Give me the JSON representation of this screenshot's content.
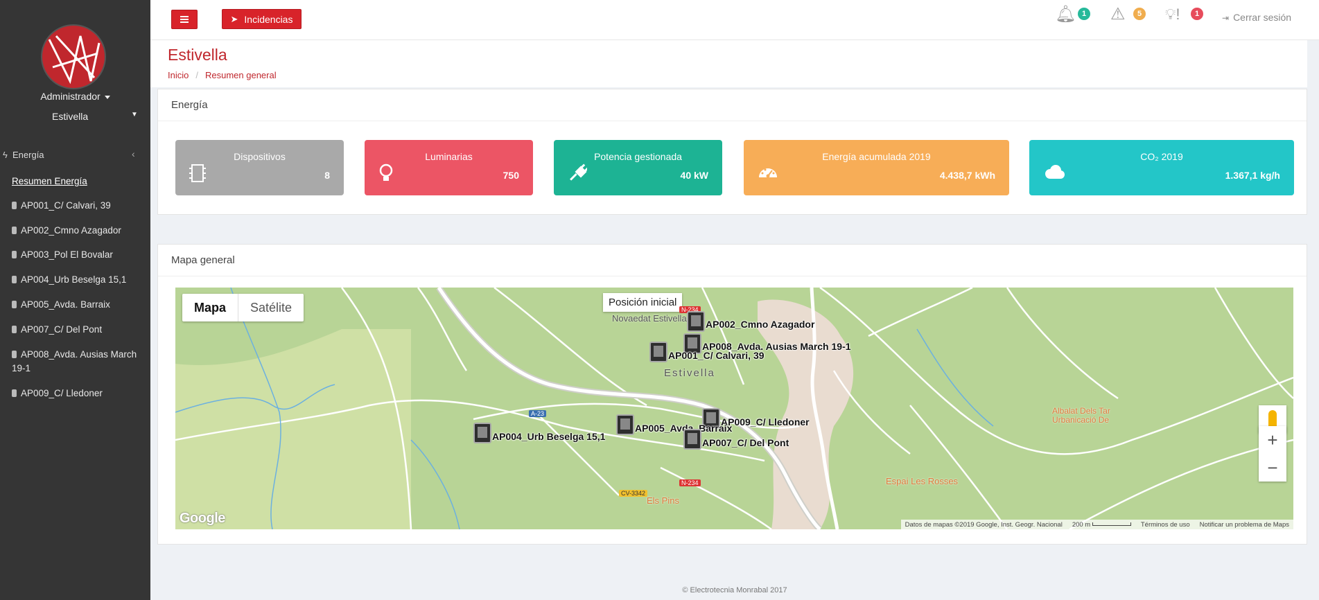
{
  "sidebar": {
    "user_role": "Administrador",
    "site": "Estivella",
    "group": {
      "label": "Energía"
    },
    "items": [
      {
        "label": "Resumen Energía",
        "active": true
      },
      {
        "label": "AP001_C/ Calvari, 39"
      },
      {
        "label": "AP002_Cmno Azagador"
      },
      {
        "label": "AP003_Pol El Bovalar"
      },
      {
        "label": "AP004_Urb Beselga 15,1"
      },
      {
        "label": "AP005_Avda. Barraix"
      },
      {
        "label": "AP007_C/ Del Pont"
      },
      {
        "label": "AP008_Avda. Ausias March 19-1"
      },
      {
        "label": "AP009_C/ Lledoner"
      }
    ]
  },
  "header": {
    "incidencias_label": "Incidencias",
    "notifications_count": "1",
    "warnings_count": "5",
    "lamp_alerts_count": "1",
    "logout_label": "Cerrar sesión",
    "colors": {
      "green": "#26b99a",
      "orange": "#f0ad4e",
      "red": "#e74c5c"
    }
  },
  "page": {
    "title": "Estivella",
    "breadcrumb": [
      "Inicio",
      "Resumen general"
    ]
  },
  "energy_panel": {
    "title": "Energía",
    "stats": [
      {
        "label": "Dispositivos",
        "value": "8",
        "icon": "chip-icon",
        "color": "#a9a9a9"
      },
      {
        "label": "Luminarias",
        "value": "750",
        "icon": "lightbulb-icon",
        "color": "#ec5565"
      },
      {
        "label": "Potencia gestionada",
        "value": "40 kW",
        "icon": "plug-icon",
        "color": "#1db394"
      },
      {
        "label": "Energía acumulada 2019",
        "value": "4.438,7 kWh",
        "icon": "gauge-icon",
        "color": "#f7ad57"
      },
      {
        "label": "CO₂ 2019",
        "value": "1.367,1 kg/h",
        "icon": "cloud-icon",
        "color": "#23c6c8"
      }
    ]
  },
  "map_panel": {
    "title": "Mapa general",
    "map_type": {
      "map": "Mapa",
      "satellite": "Satélite"
    },
    "tooltip": "Posición inicial",
    "markers": [
      "AP002_Cmno Azagador",
      "AP008_Avda. Ausias March 19-1",
      "AP001_C/ Calvari, 39",
      "AP009_C/ Lledoner",
      "AP005_Avda. Barraix",
      "AP007_C/ Del Pont",
      "AP004_Urb Beselga 15,1"
    ],
    "places": {
      "novaedat": "Novaedat Estivella",
      "town": "Estivella",
      "espai": "Espai Les Rosses",
      "albalat": "Albalat Dels Tar Urbanicació De",
      "els_pins": "Els Pins"
    },
    "roads": {
      "a23": "A-23",
      "n234a": "N-234",
      "n234b": "N-234",
      "cv3342": "CV-3342"
    },
    "logo": "Google",
    "attribution": {
      "data": "Datos de mapas ©2019 Google, Inst. Geogr. Nacional",
      "scale": "200 m",
      "terms": "Términos de uso",
      "report": "Notificar un problema de Maps"
    }
  },
  "footer": "© Electrotecnia Monrabal 2017"
}
